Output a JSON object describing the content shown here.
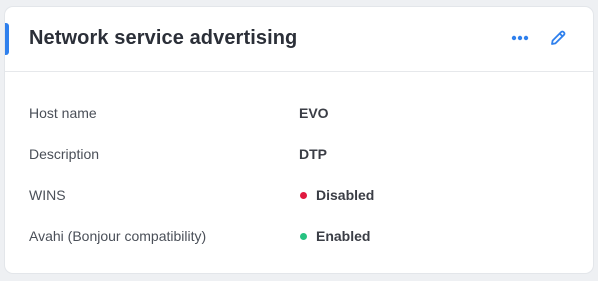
{
  "card": {
    "title": "Network service advertising",
    "accent_color": "#2f80ed",
    "actions": [
      {
        "icon": "more-horizontal-icon"
      },
      {
        "icon": "pencil-edit-icon"
      }
    ]
  },
  "rows": [
    {
      "label": "Host name",
      "value": "EVO"
    },
    {
      "label": "Description",
      "value": "DTP"
    },
    {
      "label": "WINS",
      "value": "Disabled",
      "status_color": "#e0183f"
    },
    {
      "label": "Avahi (Bonjour compatibility)",
      "value": "Enabled",
      "status_color": "#26c281"
    }
  ]
}
